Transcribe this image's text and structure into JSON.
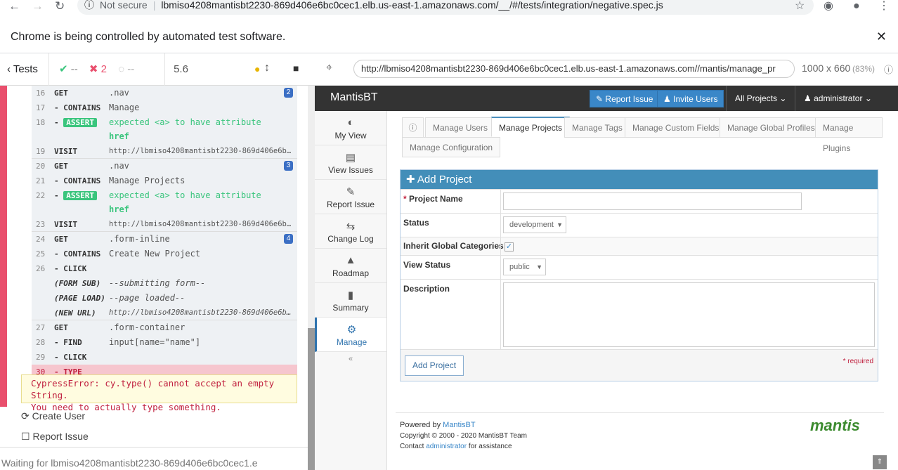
{
  "browser": {
    "not_secure": "Not secure",
    "url": "lbmiso4208mantisbt2230-869d406e6bc0cec1.elb.us-east-1.amazonaws.com/__/#/tests/integration/negative.spec.js",
    "infobar_text": "Chrome is being controlled by automated test software."
  },
  "runner": {
    "tests_label": "Tests",
    "passed": "--",
    "failed": "2",
    "pending": "--",
    "duration": "5.6",
    "aut_url": "http://lbmiso4208mantisbt2230-869d406e6bc0cec1.elb.us-east-1.amazonaws.com//mantis/manage_pr",
    "viewport": "1000 x 660",
    "scale": "(83%)",
    "error_line1": "CypressError: cy.type() cannot accept an empty String.",
    "error_line2": "You need to actually type something.",
    "tests": [
      "Create User",
      "Report Issue"
    ],
    "waiting": "Waiting for lbmiso4208mantisbt2230-869d406e6bc0cec1.e",
    "commands": [
      {
        "n": "16",
        "cmd": "GET",
        "msg": ".nav",
        "badge": "2"
      },
      {
        "n": "17",
        "cmd": "- CONTAINS",
        "msg": "Manage"
      },
      {
        "n": "18",
        "cmd": "- ASSERT",
        "msg": "expected <a> to have attribute",
        "msg2": "href",
        "assert": true
      },
      {
        "n": "19",
        "cmd": "VISIT",
        "msg": "http://lbmiso4208mantisbt2230-869d406e6bc…",
        "url": true
      },
      {
        "n": "20",
        "cmd": "GET",
        "msg": ".nav",
        "badge": "3"
      },
      {
        "n": "21",
        "cmd": "- CONTAINS",
        "msg": "Manage Projects"
      },
      {
        "n": "22",
        "cmd": "- ASSERT",
        "msg": "expected <a> to have attribute",
        "msg2": "href",
        "assert": true
      },
      {
        "n": "23",
        "cmd": "VISIT",
        "msg": "http://lbmiso4208mantisbt2230-869d406e6bc…",
        "url": true
      },
      {
        "n": "24",
        "cmd": "GET",
        "msg": ".form-inline",
        "badge": "4"
      },
      {
        "n": "25",
        "cmd": "- CONTAINS",
        "msg": "Create New Project"
      },
      {
        "n": "26",
        "cmd": "- CLICK",
        "msg": ""
      },
      {
        "n": "",
        "cmd": "(FORM SUB)",
        "msg": "--submitting form--",
        "ital": true
      },
      {
        "n": "",
        "cmd": "(PAGE LOAD)",
        "msg": "--page loaded--",
        "ital": true
      },
      {
        "n": "",
        "cmd": "(NEW URL)",
        "msg": "http://lbmiso4208mantisbt2230-869d406e6bc…",
        "ital": true,
        "url": true
      },
      {
        "n": "27",
        "cmd": "GET",
        "msg": ".form-container"
      },
      {
        "n": "28",
        "cmd": "- FIND",
        "msg": "input[name=\"name\"]"
      },
      {
        "n": "29",
        "cmd": "- CLICK",
        "msg": ""
      },
      {
        "n": "30",
        "cmd": "- TYPE",
        "msg": "",
        "error": true
      }
    ]
  },
  "mantis": {
    "brand": "MantisBT",
    "report_issue": "Report Issue",
    "invite_users": "Invite Users",
    "all_projects": "All Projects",
    "user": "administrator",
    "sidebar": [
      "My View",
      "View Issues",
      "Report Issue",
      "Change Log",
      "Roadmap",
      "Summary",
      "Manage"
    ],
    "tabs": [
      "Manage Users",
      "Manage Projects",
      "Manage Tags",
      "Manage Custom Fields",
      "Manage Global Profiles",
      "Manage Plugins",
      "Manage Configuration"
    ],
    "panel_title": "Add Project",
    "fields": {
      "project_name": "Project Name",
      "status": "Status",
      "status_value": "development",
      "inherit": "Inherit Global Categories",
      "view_status": "View Status",
      "view_status_value": "public",
      "description": "Description"
    },
    "add_button": "Add Project",
    "required": "* required",
    "footer": {
      "powered": "Powered by",
      "powered_link": "MantisBT",
      "copyright": "Copyright © 2000 - 2020 MantisBT Team",
      "contact": "Contact",
      "contact_link": "administrator",
      "contact_tail": "for assistance",
      "logo": "mantis"
    }
  }
}
